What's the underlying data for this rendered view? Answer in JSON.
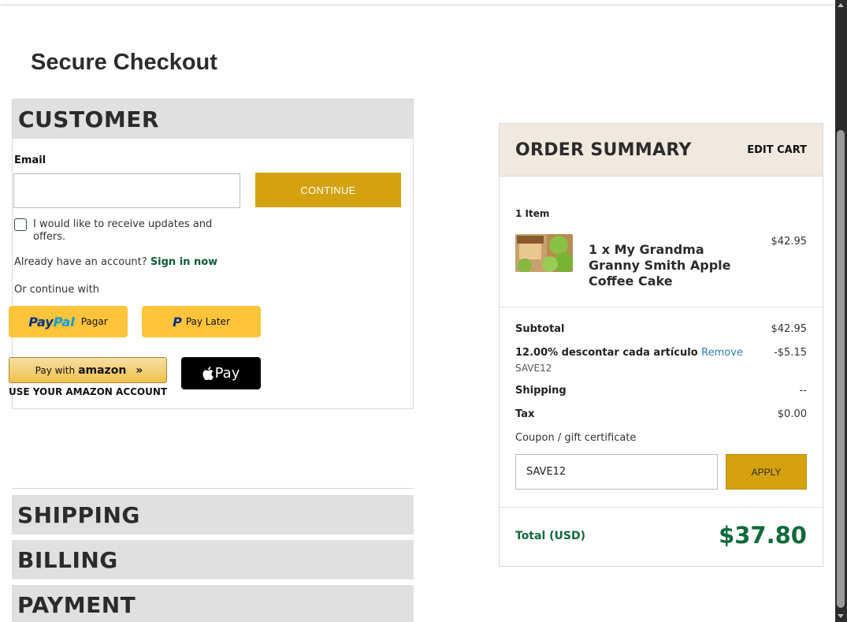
{
  "page": {
    "title": "Secure Checkout"
  },
  "customer": {
    "header": "CUSTOMER",
    "email_label": "Email",
    "email_value": "",
    "continue_label": "CONTINUE",
    "updates_label": "I would like to receive updates and offers.",
    "account_prompt": "Already have an account?",
    "sign_in_label": "Sign in now",
    "or_continue": "Or continue with",
    "paypal": {
      "pay": "Pay",
      "pal": "Pal",
      "sub": "Pagar"
    },
    "paylater": {
      "label": "Pay Later"
    },
    "amazon": {
      "prefix": "Pay with",
      "brand": "amazon",
      "arrows": "»",
      "caption": "USE YOUR AMAZON ACCOUNT"
    },
    "applepay": {
      "label": "Pay"
    }
  },
  "sections": {
    "shipping": "SHIPPING",
    "billing": "BILLING",
    "payment": "PAYMENT"
  },
  "summary": {
    "title": "ORDER SUMMARY",
    "edit_cart": "EDIT CART",
    "item_count": "1 Item",
    "item": {
      "name": "1 x My Grandma Granny Smith Apple Coffee Cake",
      "price": "$42.95",
      "image": "apple-coffee-cake"
    },
    "subtotal_label": "Subtotal",
    "subtotal_value": "$42.95",
    "discount_label": "12.00% descontar cada artículo",
    "remove_label": "Remove",
    "discount_value": "-$5.15",
    "discount_code": "SAVE12",
    "shipping_label": "Shipping",
    "shipping_value": "--",
    "tax_label": "Tax",
    "tax_value": "$0.00",
    "coupon_label": "Coupon / gift certificate",
    "coupon_value": "SAVE12",
    "apply_label": "APPLY",
    "total_label": "Total (USD)",
    "total_value": "$37.80"
  },
  "colors": {
    "accent_gold": "#d4a20f",
    "total_green": "#0f6a3a",
    "paypal_yellow": "#ffc439",
    "link_blue": "#2d7fb8"
  }
}
